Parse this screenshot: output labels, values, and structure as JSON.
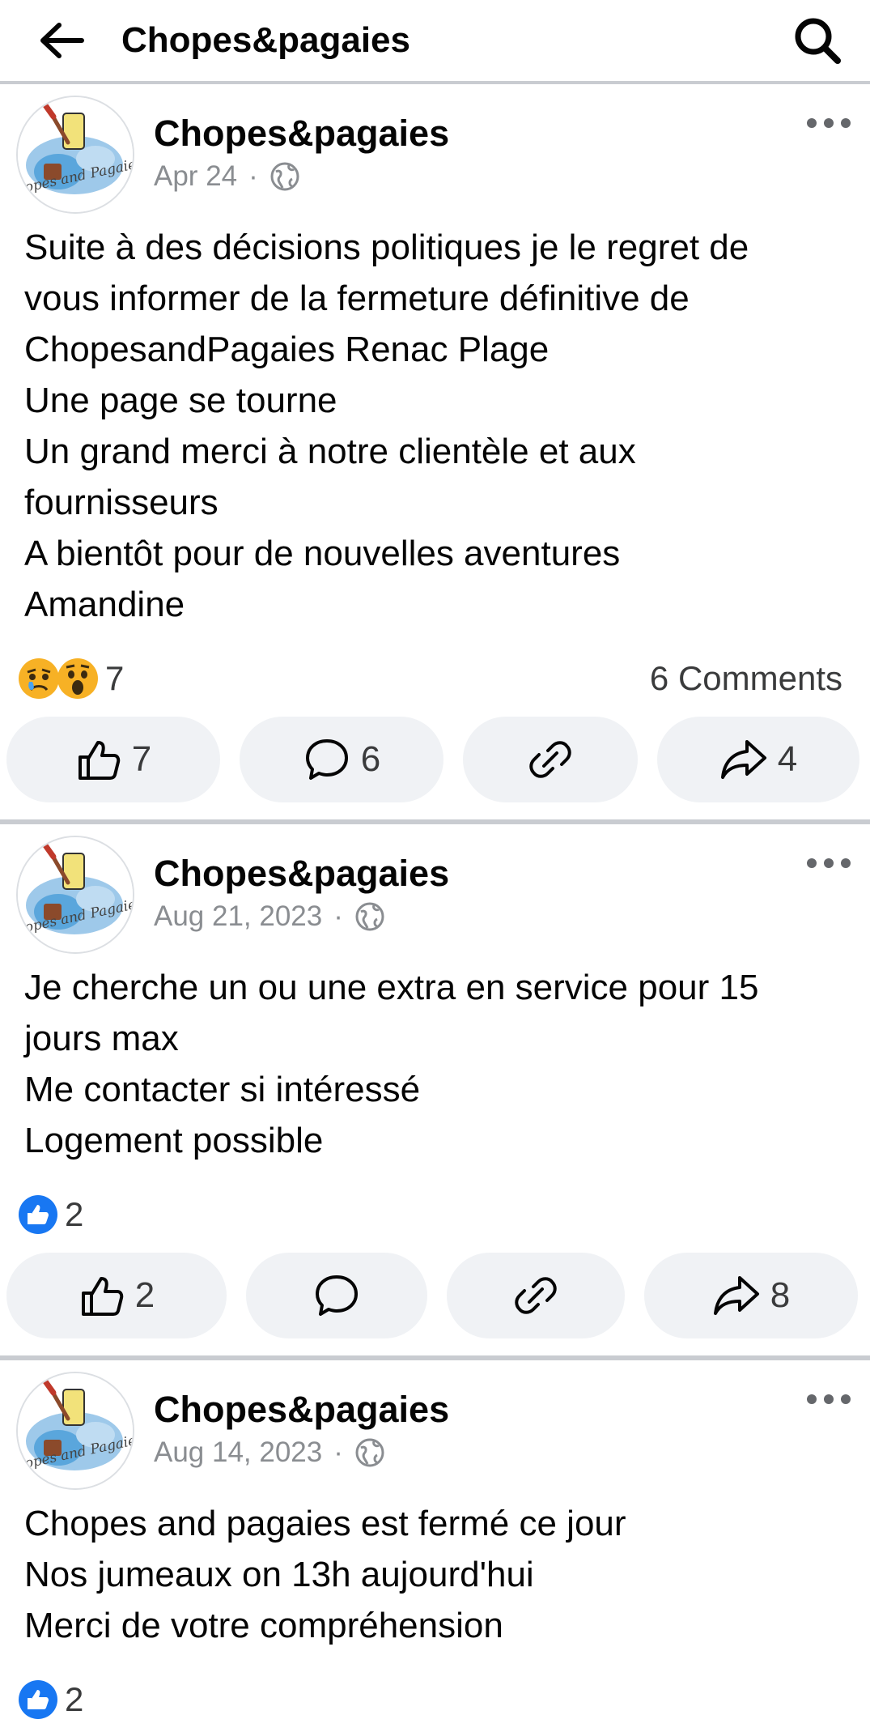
{
  "header": {
    "title": "Chopes&pagaies",
    "back_icon": "arrow-left-icon",
    "search_icon": "search-icon"
  },
  "posts": [
    {
      "author": "Chopes&pagaies",
      "date": "Apr 24",
      "dot": "·",
      "audience_icon": "globe-icon",
      "lines": [
        "Suite à des décisions politiques je le regret de",
        "vous informer de la fermeture définitive de",
        "ChopesandPagaies Renac Plage",
        "Une page se tourne",
        "Un grand merci à notre clientèle et aux",
        "fournisseurs",
        "A bientôt pour de nouvelles aventures",
        "Amandine"
      ],
      "reactions": [
        "sad-emoji",
        "wow-emoji"
      ],
      "reaction_count": "7",
      "comments_label": "6 Comments",
      "actions": {
        "like": "7",
        "comment": "6",
        "link": "",
        "share": "4"
      }
    },
    {
      "author": "Chopes&pagaies",
      "date": "Aug 21, 2023",
      "dot": "·",
      "audience_icon": "globe-icon",
      "lines": [
        "Je cherche un ou une extra en service pour 15",
        "jours max",
        "Me contacter si intéressé",
        "Logement possible"
      ],
      "reactions": [
        "like-emoji"
      ],
      "reaction_count": "2",
      "comments_label": "",
      "actions": {
        "like": "2",
        "comment": "",
        "link": "",
        "share": "8"
      }
    },
    {
      "author": "Chopes&pagaies",
      "date": "Aug 14, 2023",
      "dot": "·",
      "audience_icon": "globe-icon",
      "lines": [
        "Chopes and pagaies est fermé ce jour",
        "Nos jumeaux on 13h aujourd'hui",
        "Merci de votre compréhension"
      ],
      "reactions": [
        "like-emoji"
      ],
      "reaction_count": "2",
      "comments_label": "",
      "actions": null
    }
  ],
  "colors": {
    "like_blue": "#1877f2",
    "pill_bg": "#f0f2f5",
    "separator": "#c9ccd1",
    "meta_gray": "#8a8d91"
  }
}
